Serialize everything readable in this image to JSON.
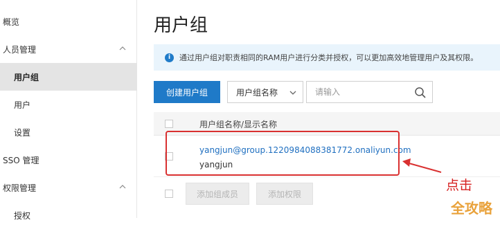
{
  "sidebar": {
    "items": [
      {
        "label": "概览",
        "level": 1,
        "active": false,
        "chevron": null
      },
      {
        "label": "人员管理",
        "level": 1,
        "active": false,
        "chevron": "up"
      },
      {
        "label": "用户组",
        "level": 2,
        "active": true,
        "chevron": null
      },
      {
        "label": "用户",
        "level": 2,
        "active": false,
        "chevron": null
      },
      {
        "label": "设置",
        "level": 2,
        "active": false,
        "chevron": null
      },
      {
        "label": "SSO 管理",
        "level": 1,
        "active": false,
        "chevron": null
      },
      {
        "label": "权限管理",
        "level": 1,
        "active": false,
        "chevron": "up"
      },
      {
        "label": "授权",
        "level": 2,
        "active": false,
        "chevron": null
      }
    ]
  },
  "main": {
    "title": "用户组",
    "info_text": "通过用户组对职责相同的RAM用户进行分类并授权，可以更加高效地管理用户及其权限。",
    "info_icon": "info-icon",
    "create_label": "创建用户组",
    "search_type": "用户组名称",
    "search_placeholder": "请输入",
    "table": {
      "column_header": "用户组名称/显示名称",
      "rows": [
        {
          "name": "yangjun@group.1220984088381772.onaliyun.com",
          "display_name": "yangjun"
        }
      ]
    },
    "add_member_label": "添加组成员",
    "add_permission_label": "添加权限"
  },
  "annotation": {
    "text": "点击",
    "color": "#d62020"
  },
  "watermark": "全攻略",
  "colors": {
    "accent": "#1f7ac8",
    "link": "#1f6fc0",
    "info_bg": "#e9f4fc",
    "highlight": "#d93030"
  }
}
